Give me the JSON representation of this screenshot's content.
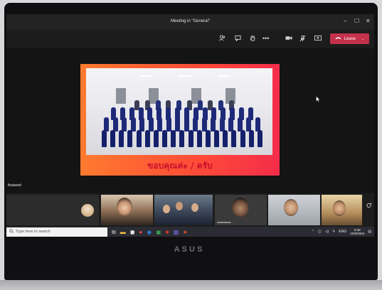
{
  "window": {
    "title": "Meeting in \"General\"",
    "minimize": "–",
    "maximize": "☐",
    "close": "✕"
  },
  "toolbar": {
    "leave_label": "Leave",
    "more_label": "•••"
  },
  "presentation": {
    "caption": "ขอบคุณค่ะ / ครับ",
    "presenter_name": "thaiaesd"
  },
  "gallery": {
    "tiles": [
      {
        "label": ""
      },
      {
        "label": ""
      },
      {
        "label": ""
      },
      {
        "label": "chaiedruss"
      },
      {
        "label": ""
      },
      {
        "label": ""
      }
    ]
  },
  "taskbar": {
    "search_placeholder": "Type here to search",
    "language": "ENG",
    "time": "9:38",
    "date": "20/8/2563"
  },
  "laptop": {
    "brand": "ASUS"
  },
  "colors": {
    "leave_red": "#c4314b",
    "slide_orange": "#ff5a33",
    "caption_red": "#c8102e",
    "uniform_navy": "#1e2a78"
  }
}
